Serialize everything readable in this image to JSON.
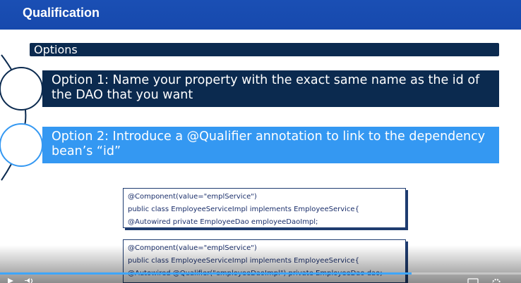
{
  "header": {
    "title": "Qualification"
  },
  "section": {
    "label": "Options"
  },
  "options": [
    {
      "text": "Option 1: Name your property with the exact same name as the id of the DAO that you want"
    },
    {
      "text": "Option 2: Introduce a @Qualifier annotation to link to the dependency bean’s “id”"
    }
  ],
  "code_blocks": [
    {
      "lines": [
        "@Component(value=\"emplService\")",
        "public class EmployeeServiceImpl implements EmployeeService{",
        "@Autowired private EmployeeDao employeeDaoImpl;"
      ]
    },
    {
      "lines": [
        "@Component(value=\"emplService\")",
        "public class EmployeeServiceImpl implements EmployeeService{",
        "@Autowired @Qualifier(\"employeeDaoImpl\") private EmployeeDao dao;"
      ]
    }
  ],
  "player": {
    "progress": 0.79
  },
  "colors": {
    "title_bar": "#1a4fb4",
    "dark_navy": "#0b2a4f",
    "accent_blue": "#3498f2",
    "code_text": "#1b2f6b"
  },
  "icons": [
    "play-icon",
    "volume-icon",
    "subtitles-icon",
    "settings-icon"
  ]
}
